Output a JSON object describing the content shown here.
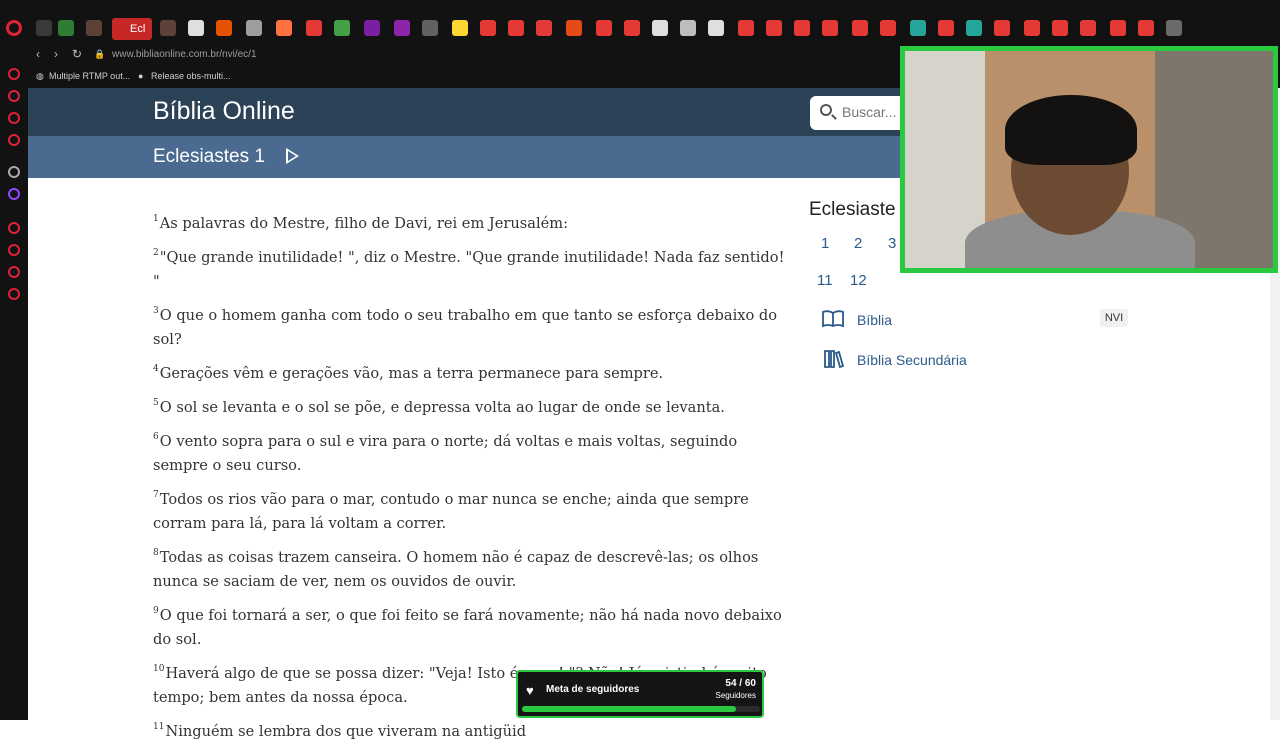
{
  "browser": {
    "active_tab_label": "Ecl",
    "url": "www.bibliaonline.com.br/nvi/ec/1",
    "bookmarks": [
      "Multiple RTMP out...",
      "Release obs-multi..."
    ]
  },
  "site": {
    "title": "Bíblia Online",
    "search_placeholder": "Buscar...",
    "chapter_title": "Eclesiastes 1"
  },
  "verses": [
    {
      "n": "1",
      "text": "As palavras do Mestre, filho de Davi, rei em Jerusalém:"
    },
    {
      "n": "2",
      "text": "\"Que grande inutilidade! \", diz o Mestre. \"Que grande inutilidade! Nada faz sentido! \""
    },
    {
      "n": "3",
      "text": "O que o homem ganha com todo o seu trabalho em que tanto se esforça debaixo do sol?"
    },
    {
      "n": "4",
      "text": "Gerações vêm e gerações vão, mas a terra permanece para sempre."
    },
    {
      "n": "5",
      "text": "O sol se levanta e o sol se põe, e depressa volta ao lugar de onde se levanta."
    },
    {
      "n": "6",
      "text": "O vento sopra para o sul e vira para o norte; dá voltas e mais voltas, seguindo sempre o seu curso."
    },
    {
      "n": "7",
      "text": "Todos os rios vão para o mar, contudo o mar nunca se enche; ainda que sempre corram para lá, para lá voltam a correr."
    },
    {
      "n": "8",
      "text": "Todas as coisas trazem canseira. O homem não é capaz de descrevê-las; os olhos nunca se saciam de ver, nem os ouvidos de ouvir."
    },
    {
      "n": "9",
      "text": "O que foi tornará a ser, o que foi feito se fará novamente; não há nada novo debaixo do sol."
    },
    {
      "n": "10",
      "text": "Haverá algo de que se possa dizer: \"Veja! Isto é novo! \"? Não! Já existiu há muito tempo; bem antes da nossa época."
    },
    {
      "n": "11",
      "text": "Ninguém se lembra dos que viveram na antigüid"
    }
  ],
  "sidebar": {
    "title": "Eclesiaste",
    "chapters": [
      "1",
      "2",
      "3",
      "11",
      "12"
    ],
    "links": [
      {
        "label": "Bíblia",
        "badge": "NVI"
      },
      {
        "label": "Bíblia Secundária"
      }
    ]
  },
  "widget": {
    "label": "Meta de seguidores",
    "count": "54 / 60",
    "sub": "Seguidores",
    "progress": 0.9
  },
  "colors": {
    "header_dark": "#2c4257",
    "header_light": "#4a6b8f",
    "link": "#2b5a8a",
    "stream_green": "#29c940"
  }
}
